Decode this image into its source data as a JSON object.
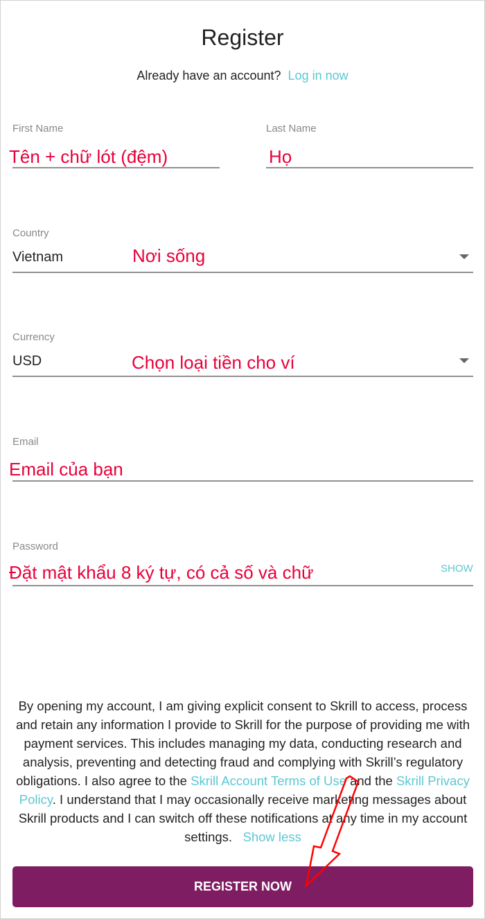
{
  "header": {
    "title": "Register",
    "already_text": "Already have an account?",
    "login_link": "Log in now"
  },
  "form": {
    "first_name": {
      "label": "First Name",
      "annotation": "Tên + chữ lót (đệm)"
    },
    "last_name": {
      "label": "Last Name",
      "annotation": "Họ"
    },
    "country": {
      "label": "Country",
      "value": "Vietnam",
      "annotation": "Nơi sống"
    },
    "currency": {
      "label": "Currency",
      "value": "USD",
      "annotation": "Chọn loại tiền cho ví"
    },
    "email": {
      "label": "Email",
      "annotation": "Email của bạn"
    },
    "password": {
      "label": "Password",
      "annotation": "Đặt mật khẩu 8 ký tự, có cả số và chữ",
      "show_label": "SHOW"
    }
  },
  "consent": {
    "text1": "By opening my account, I am giving explicit consent to Skrill to access, process and retain any information I provide to Skrill for the purpose of providing me with payment services. This includes managing my data, conducting research and analysis, preventing and detecting fraud and complying with Skrill’s regulatory obligations. I also agree to the ",
    "terms_link": "Skrill Account Terms of Use",
    "text2": " and the ",
    "privacy_link": "Skrill Privacy Policy",
    "text3": ". I understand that I may occasionally receive marketing messages about Skrill products and I can switch off these notifications at any time in my account settings.",
    "show_less": "Show less"
  },
  "register_button": "REGISTER NOW",
  "colors": {
    "accent": "#5bc7d3",
    "button": "#7f1d63",
    "annotation": "#e8003a"
  }
}
